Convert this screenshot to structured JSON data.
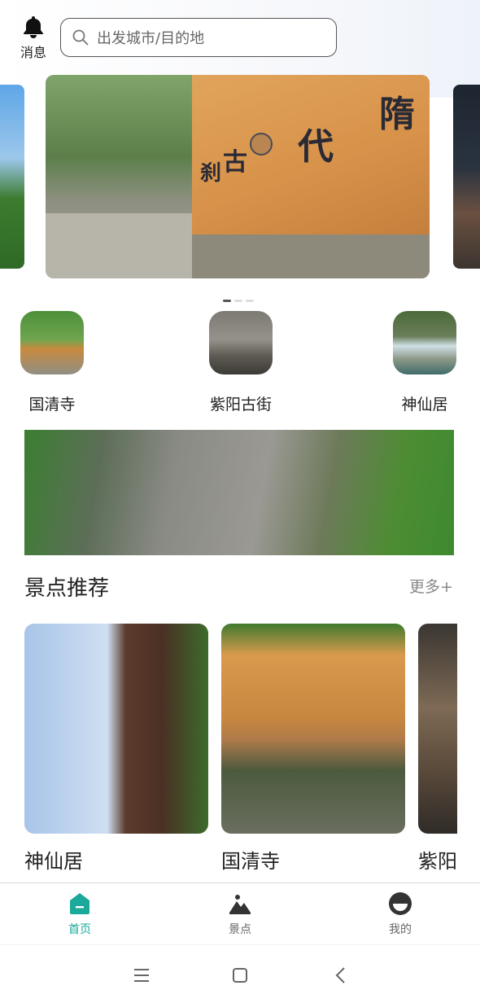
{
  "header": {
    "message_label": "消息",
    "search_placeholder": "出发城市/目的地",
    "icons": {
      "message": "bell-icon",
      "search": "search-icon"
    }
  },
  "carousel": {
    "slides": 3,
    "active_index": 0,
    "main_wall_characters": [
      "隋",
      "代",
      "古",
      "刹"
    ]
  },
  "quick_entries": [
    {
      "label": "国清寺"
    },
    {
      "label": "紫阳古街"
    },
    {
      "label": "神仙居"
    }
  ],
  "recommend": {
    "title": "景点推荐",
    "more_label": "更多+",
    "cards": [
      {
        "name": "神仙居"
      },
      {
        "name": "国清寺"
      },
      {
        "name": "紫阳"
      }
    ]
  },
  "tabbar": {
    "active": "home",
    "accent_color": "#1aa99a",
    "items": [
      {
        "label": "首页",
        "icon": "home-icon"
      },
      {
        "label": "景点",
        "icon": "mountain-icon"
      },
      {
        "label": "我的",
        "icon": "profile-icon"
      }
    ]
  },
  "system_nav": {
    "icons": [
      "menu-icon",
      "home-square-icon",
      "back-icon"
    ]
  }
}
